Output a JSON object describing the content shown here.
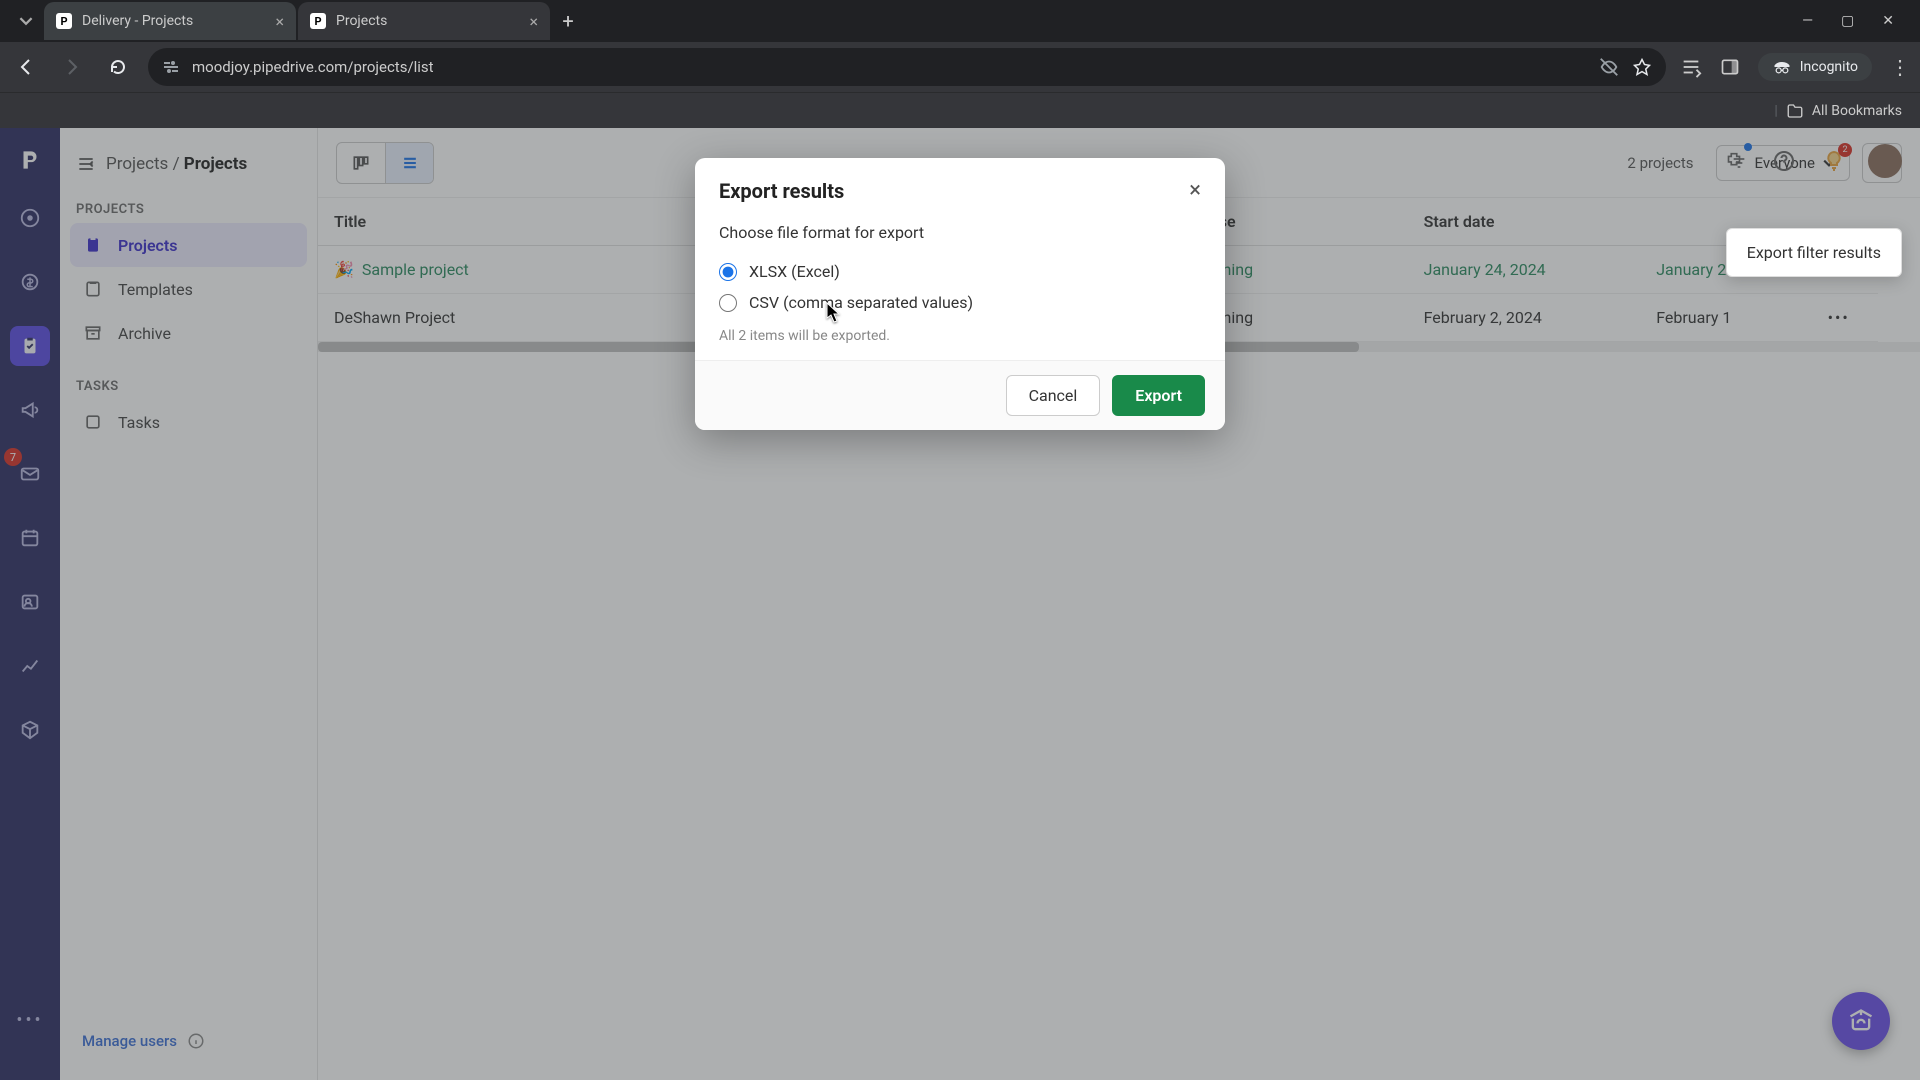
{
  "browser": {
    "tabs": [
      {
        "title": "Delivery - Projects"
      },
      {
        "title": "Projects"
      }
    ],
    "url": "moodjoy.pipedrive.com/projects/list",
    "incognito_label": "Incognito",
    "all_bookmarks": "All Bookmarks"
  },
  "rail": {
    "mail_badge": "7"
  },
  "breadcrumb": {
    "parent": "Projects",
    "current": "Projects"
  },
  "sidebar": {
    "sections": {
      "projects": "PROJECTS",
      "tasks": "TASKS"
    },
    "items": {
      "projects": "Projects",
      "templates": "Templates",
      "archive": "Archive",
      "tasks": "Tasks"
    },
    "manage_users": "Manage users"
  },
  "toolbar": {
    "count": "2 projects",
    "filter_label": "Everyone"
  },
  "popover": {
    "export_filter": "Export filter results"
  },
  "table": {
    "cols": {
      "title": "Title",
      "phase": "Phase",
      "start": "Start date",
      "end": ""
    },
    "rows": [
      {
        "emoji": "🎉",
        "title": "Sample project",
        "phase": "Planning",
        "start": "January 24, 2024",
        "end": "January 2"
      },
      {
        "emoji": "",
        "title": "DeShawn Project",
        "phase": "Planning",
        "start": "February 2, 2024",
        "end": "February 1"
      }
    ]
  },
  "header_icons": {
    "tip_badge": "2"
  },
  "modal": {
    "title": "Export results",
    "prompt": "Choose file format for export",
    "opt_xlsx": "XLSX (Excel)",
    "opt_csv": "CSV (comma separated values)",
    "hint": "All 2 items will be exported.",
    "cancel": "Cancel",
    "export": "Export"
  }
}
